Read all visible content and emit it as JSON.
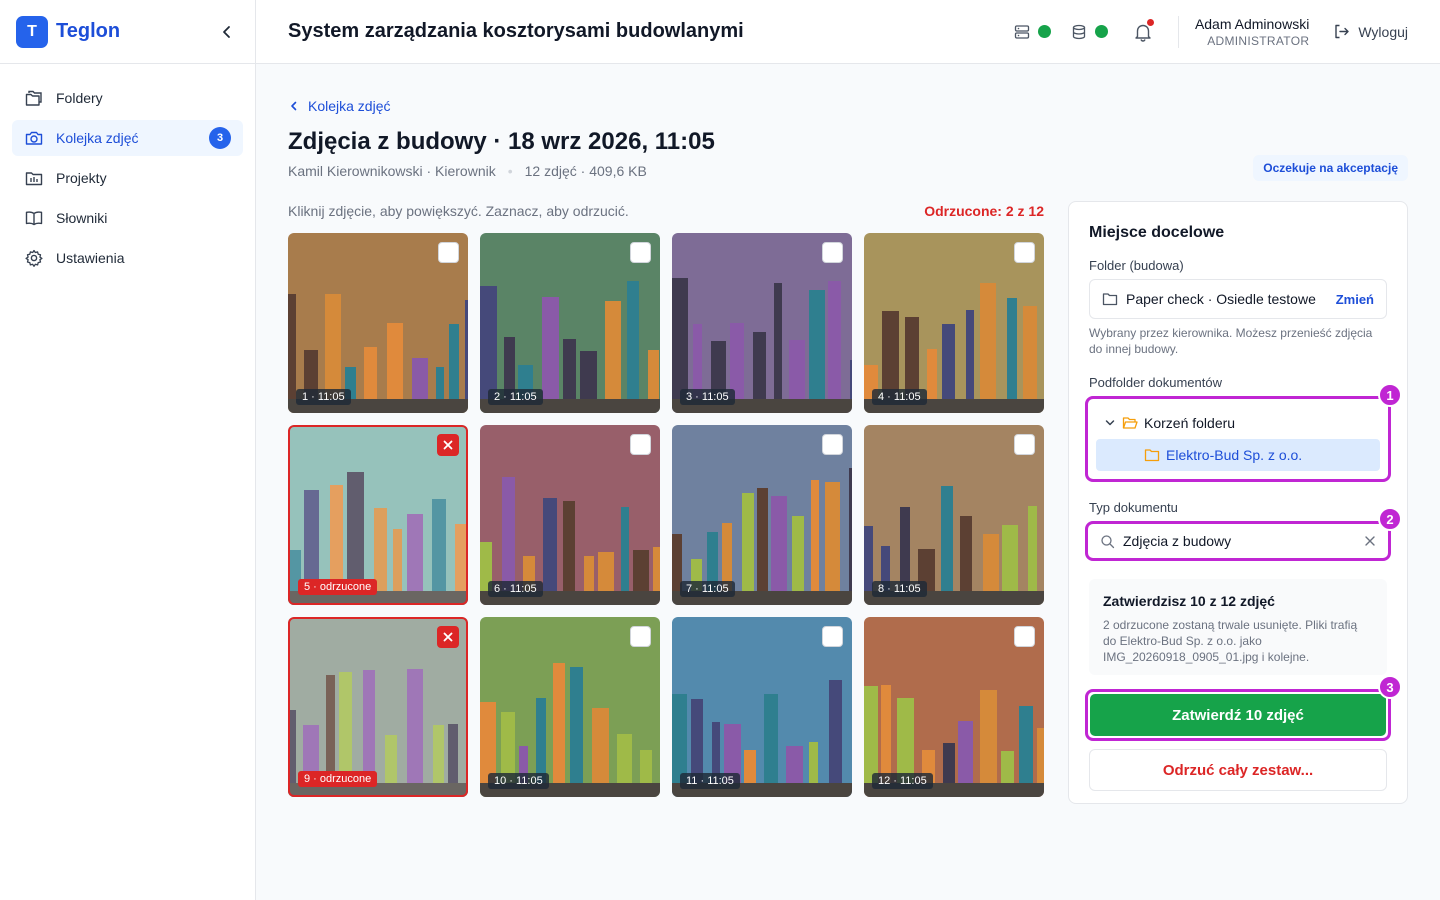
{
  "brand": {
    "logo_letter": "T",
    "name": "Teglon"
  },
  "sidebar": {
    "items": [
      {
        "label": "Foldery",
        "icon": "folders-icon"
      },
      {
        "label": "Kolejka zdjęć",
        "icon": "camera-icon",
        "badge": "3",
        "active": true
      },
      {
        "label": "Projekty",
        "icon": "projects-icon"
      },
      {
        "label": "Słowniki",
        "icon": "book-icon"
      },
      {
        "label": "Ustawienia",
        "icon": "gear-icon"
      }
    ]
  },
  "header": {
    "title": "System zarządzania kosztorysami budowlanymi",
    "user_name": "Adam Adminowski",
    "user_role": "ADMINISTRATOR",
    "logout_label": "Wyloguj",
    "status_color": "#16a34a"
  },
  "page": {
    "back_label": "Kolejka zdjęć",
    "title": "Zdjęcia z budowy · 18 wrz 2026, 11:05",
    "author": "Kamil Kierownikowski · Kierownik",
    "stats": "12 zdjęć · 409,6 KB",
    "status": "Oczekuje na akceptację",
    "hint": "Kliknij zdjęcie, aby powiększyć. Zaznacz, aby odrzucić.",
    "rejected_count": "Odrzucone: 2 z 12"
  },
  "photos": [
    {
      "label": "1 · 11:05",
      "rejected": false,
      "bg": "#a87c4c"
    },
    {
      "label": "2 · 11:05",
      "rejected": false,
      "bg": "#5a8466"
    },
    {
      "label": "3 · 11:05",
      "rejected": false,
      "bg": "#7e6c96"
    },
    {
      "label": "4 · 11:05",
      "rejected": false,
      "bg": "#a8945c"
    },
    {
      "label": "5 · odrzucone",
      "rejected": true,
      "bg": "#7fb5ac"
    },
    {
      "label": "6 · 11:05",
      "rejected": false,
      "bg": "#985f6a"
    },
    {
      "label": "7 · 11:05",
      "rejected": false,
      "bg": "#6f819f"
    },
    {
      "label": "8 · 11:05",
      "rejected": false,
      "bg": "#a48462"
    },
    {
      "label": "9 · odrzucone",
      "rejected": true,
      "bg": "#8c9a8e"
    },
    {
      "label": "10 · 11:05",
      "rejected": false,
      "bg": "#7c9f55"
    },
    {
      "label": "11 · 11:05",
      "rejected": false,
      "bg": "#538aad"
    },
    {
      "label": "12 · 11:05",
      "rejected": false,
      "bg": "#b06c4c"
    }
  ],
  "panel": {
    "title": "Miejsce docelowe",
    "folder_label": "Folder (budowa)",
    "folder_value": "Paper check · Osiedle testowe",
    "change_label": "Zmień",
    "folder_help": "Wybrany przez kierownika. Możesz przenieść zdjęcia do innej budowy.",
    "subfolder_label": "Podfolder dokumentów",
    "tree_root": "Korzeń folderu",
    "tree_child": "Elektro-Bud Sp. z o.o.",
    "doctype_label": "Typ dokumentu",
    "doctype_value": "Zdjęcia z budowy",
    "summary_title": "Zatwierdzisz 10 z 12 zdjęć",
    "summary_text": "2 odrzucone zostaną trwale usunięte. Pliki trafią do Elektro-Bud Sp. z o.o. jako IMG_20260918_0905_01.jpg i kolejne.",
    "approve_label": "Zatwierdź 10 zdjęć",
    "reject_all_label": "Odrzuć cały zestaw...",
    "markers": [
      "1",
      "2",
      "3"
    ]
  }
}
